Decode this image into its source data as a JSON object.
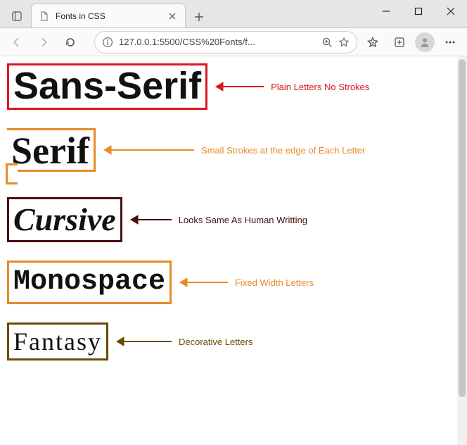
{
  "window": {
    "tab_title": "Fonts in CSS"
  },
  "toolbar": {
    "address": "127.0.0.1:5500/CSS%20Fonts/f..."
  },
  "page": {
    "rows": [
      {
        "label": "Sans-Serif",
        "note": "Plain Letters No Strokes"
      },
      {
        "label": "Serif",
        "note": "Small Strokes at the edge of Each Letter"
      },
      {
        "label": "Cursive",
        "note": "Looks Same As Human Writting"
      },
      {
        "label": "Monospace",
        "note": "Fixed Width Letters"
      },
      {
        "label": "Fantasy",
        "note": "Decorative Letters"
      }
    ]
  }
}
